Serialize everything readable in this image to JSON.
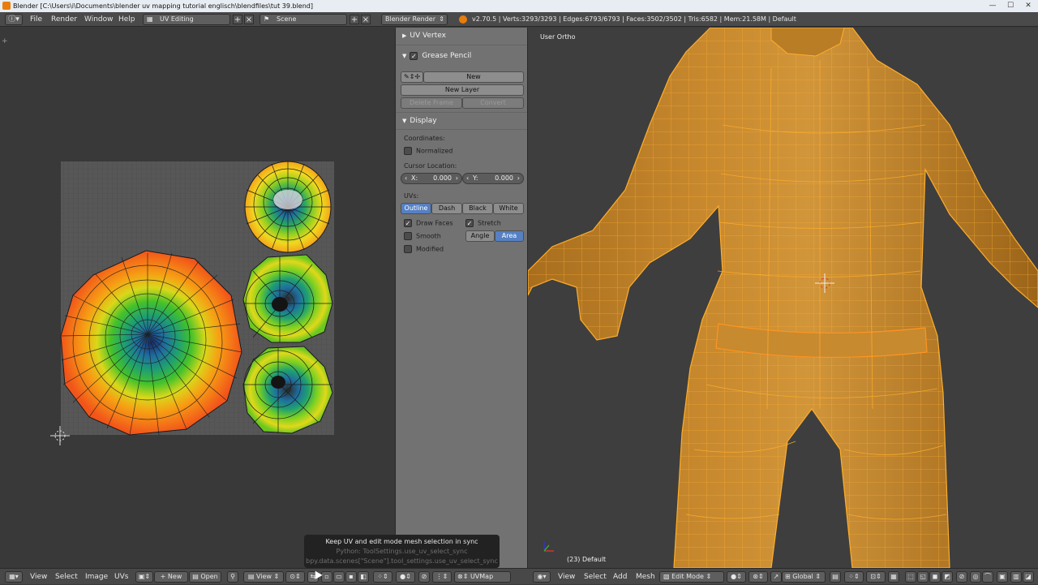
{
  "window": {
    "title": "Blender [C:\\Users\\i\\Documents\\blender uv mapping tutorial englisch\\blendfiles\\tut 39.blend]",
    "minimize": "—",
    "maximize": "☐",
    "close": "✕"
  },
  "topbar": {
    "menus": [
      "File",
      "Render",
      "Window",
      "Help"
    ],
    "screen_layout": "UV Editing",
    "scene": "Scene",
    "render_engine": "Blender Render",
    "stats": "v2.70.5 | Verts:3293/3293 | Edges:6793/6793 | Faces:3502/3502 | Tris:6582 | Mem:21.58M | Default"
  },
  "props": {
    "uv_vertex": "UV Vertex",
    "grease_pencil": "Grease Pencil",
    "new": "New",
    "new_layer": "New Layer",
    "delete_frame": "Delete Frame",
    "convert": "Convert",
    "display": "Display",
    "coordinates": "Coordinates:",
    "normalized": "Normalized",
    "cursor_location": "Cursor Location:",
    "cursor_x_label": "X:",
    "cursor_x_value": "0.000",
    "cursor_y_label": "Y:",
    "cursor_y_value": "0.000",
    "uvs_label": "UVs:",
    "uv_modes": [
      "Outline",
      "Dash",
      "Black",
      "White"
    ],
    "draw_faces": "Draw Faces",
    "stretch": "Stretch",
    "smooth": "Smooth",
    "modified": "Modified",
    "angle": "Angle",
    "area": "Area"
  },
  "viewport": {
    "view_label": "User Ortho",
    "object_label": "(23) Default"
  },
  "uv_header": {
    "menus": [
      "View",
      "Select",
      "Image",
      "UVs"
    ],
    "new": "New",
    "open": "Open",
    "view": "View",
    "uvmap": "UVMap"
  },
  "view3d_header": {
    "menus": [
      "View",
      "Select",
      "Add",
      "Mesh"
    ],
    "mode": "Edit Mode",
    "orientation": "Global"
  },
  "tooltip": {
    "line1": "Keep UV and edit mode mesh selection in sync",
    "line2": "Python: ToolSettings.use_uv_select_sync",
    "line3": "bpy.data.scenes[\"Scene\"].tool_settings.use_uv_select_sync"
  },
  "colors": {
    "accent": "#5680c2",
    "mesh": "#c8892e",
    "wire": "#ffae2a"
  }
}
